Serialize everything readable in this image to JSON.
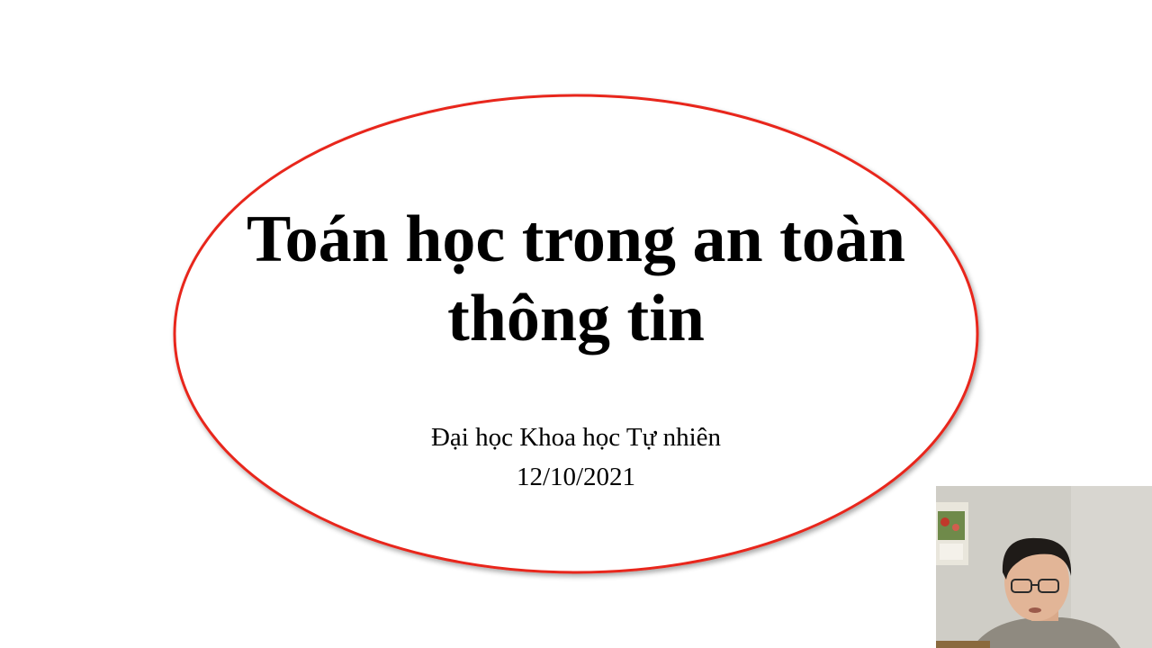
{
  "slide": {
    "title_line1": "Toán học trong an toàn",
    "title_line2": "thông tin",
    "institution": "Đại học Khoa học Tự nhiên",
    "date": "12/10/2021"
  },
  "colors": {
    "background": "#ffffff",
    "ellipse_stroke": "#e8261a",
    "text": "#000000"
  },
  "webcam": {
    "visible": true,
    "subject": "presenter with glasses"
  }
}
